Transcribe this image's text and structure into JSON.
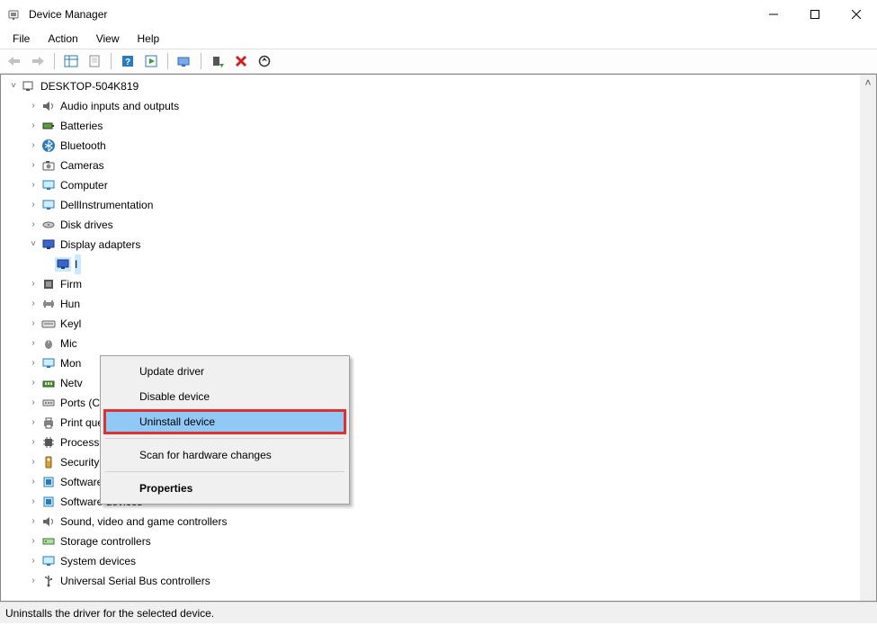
{
  "window": {
    "title": "Device Manager"
  },
  "menu": {
    "file": "File",
    "action": "Action",
    "view": "View",
    "help": "Help"
  },
  "tree": {
    "root": "DESKTOP-504K819",
    "categories": [
      "Audio inputs and outputs",
      "Batteries",
      "Bluetooth",
      "Cameras",
      "Computer",
      "DellInstrumentation",
      "Disk drives",
      "Display adapters",
      "Firm",
      "Hun",
      "Keyl",
      "Mic",
      "Mon",
      "Netv",
      "Ports (COM & LPT)",
      "Print queues",
      "Processors",
      "Security devices",
      "Software components",
      "Software devices",
      "Sound, video and game controllers",
      "Storage controllers",
      "System devices",
      "Universal Serial Bus controllers"
    ],
    "selected_child": "I"
  },
  "context": {
    "update": "Update driver",
    "disable": "Disable device",
    "uninstall": "Uninstall device",
    "scan": "Scan for hardware changes",
    "properties": "Properties"
  },
  "status": "Uninstalls the driver for the selected device."
}
